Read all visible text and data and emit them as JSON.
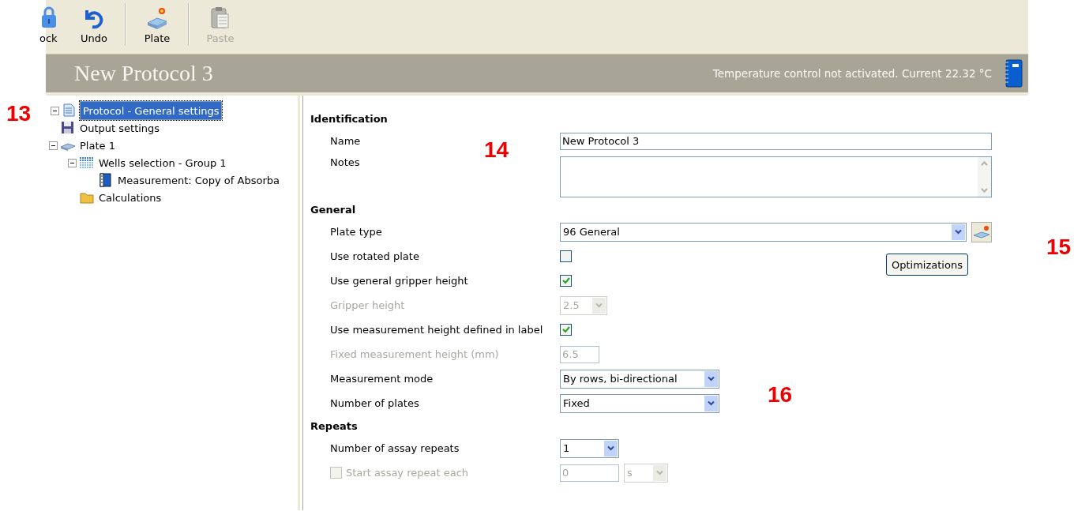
{
  "toolbar": [
    {
      "label": "ock",
      "disabled": false
    },
    {
      "label": "Undo",
      "disabled": false
    },
    {
      "label": "Plate",
      "disabled": false
    },
    {
      "label": "Paste",
      "disabled": true
    }
  ],
  "header": {
    "title": "New Protocol 3",
    "status": "Temperature control not activated. Current 22.32 °C"
  },
  "tree": [
    {
      "label": "Protocol - General settings",
      "selected": true,
      "expanded": true,
      "children": [
        {
          "label": "Output settings",
          "selected": false
        },
        {
          "label": "Plate 1",
          "selected": false,
          "expanded": true,
          "children": [
            {
              "label": "Wells selection - Group 1",
              "selected": false,
              "expanded": true,
              "children": [
                {
                  "label": "Measurement: Copy of Absorba",
                  "selected": false
                }
              ]
            },
            {
              "label": "Calculations",
              "selected": false
            }
          ]
        }
      ]
    }
  ],
  "sections": [
    {
      "title": "Identification",
      "rows": [
        {
          "kind": "text",
          "label": "Name",
          "value": "New Protocol 3",
          "disabled": false
        },
        {
          "kind": "textarea",
          "label": "Notes",
          "disabled": false
        }
      ]
    },
    {
      "title": "General",
      "rows": [
        {
          "kind": "select",
          "label": "Plate type",
          "value": "96 General",
          "disabled": false
        },
        {
          "kind": "checkbox",
          "label": "Use rotated plate",
          "checked": false,
          "disabled": false,
          "button": "Optimizations"
        },
        {
          "kind": "checkbox",
          "label": "Use general gripper height",
          "checked": true,
          "disabled": false
        },
        {
          "kind": "select",
          "label": "Gripper height",
          "value": "2.5",
          "disabled": true
        },
        {
          "kind": "checkbox",
          "label": "Use measurement height defined in label",
          "checked": true,
          "disabled": false
        },
        {
          "kind": "text",
          "label": "Fixed measurement height (mm)",
          "value": "6.5",
          "disabled": true
        },
        {
          "kind": "select",
          "label": "Measurement mode",
          "value": "By rows, bi-directional",
          "disabled": false
        },
        {
          "kind": "select",
          "label": "Number of plates",
          "value": "Fixed",
          "disabled": false
        }
      ]
    },
    {
      "title": "Repeats",
      "rows": [
        {
          "kind": "select",
          "label": "Number of assay repeats",
          "value": "1",
          "disabled": false
        },
        {
          "kind": "check_interval",
          "label": "Start assay repeat each",
          "checked": false,
          "value": "0",
          "unit": "s",
          "disabled": true
        }
      ]
    }
  ],
  "annotations": [
    {
      "text": "13"
    },
    {
      "text": "14"
    },
    {
      "text": "15"
    },
    {
      "text": "16"
    }
  ]
}
